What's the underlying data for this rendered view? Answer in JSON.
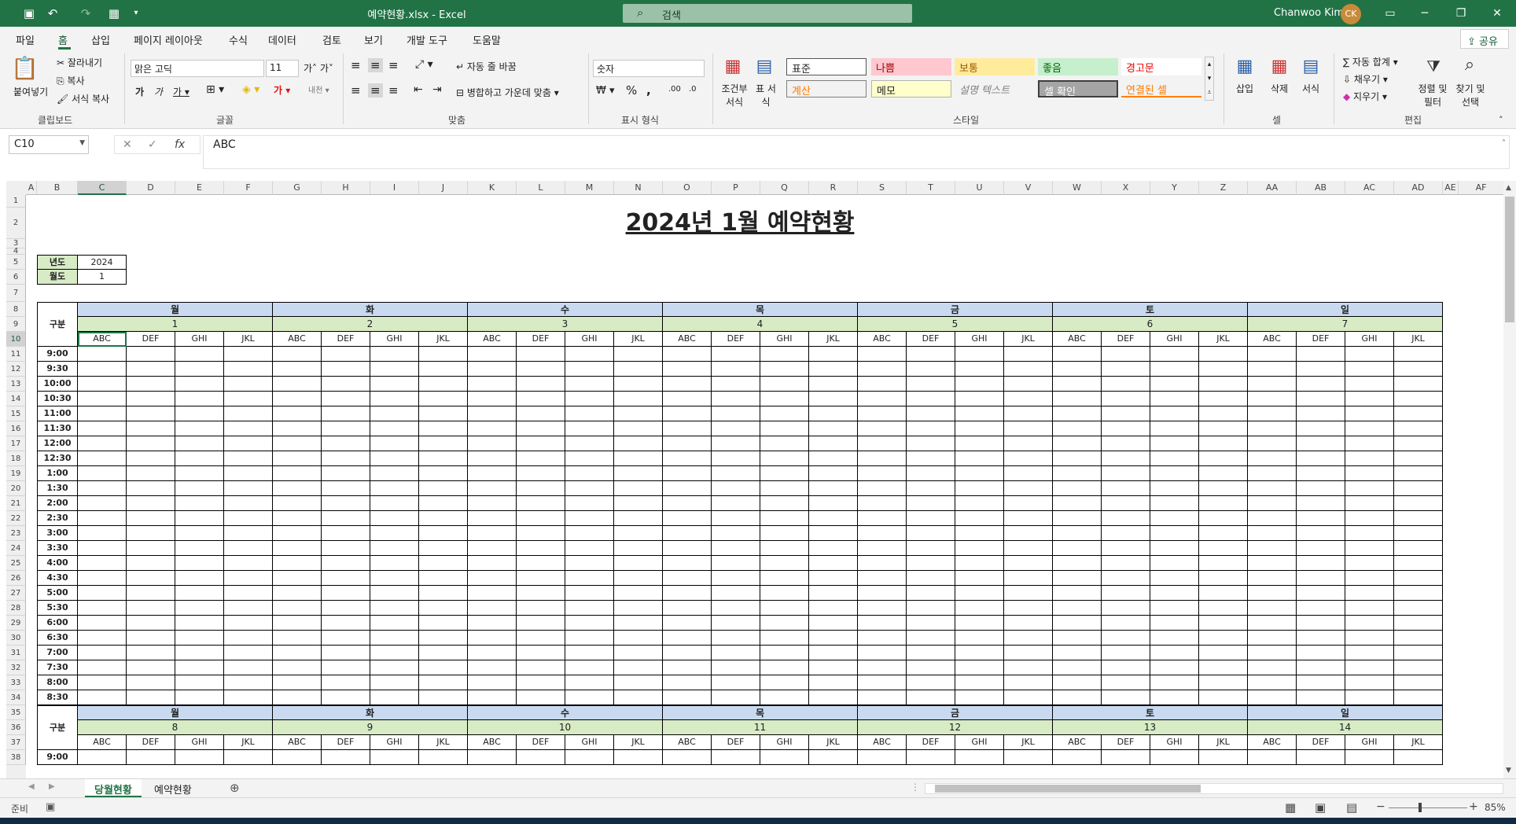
{
  "title_bar": {
    "file_title": "예약현황.xlsx  -  Excel",
    "search_placeholder": "검색",
    "user_name": "Chanwoo Kim",
    "user_initials": "CK"
  },
  "menu": {
    "tabs": [
      "파일",
      "홈",
      "삽입",
      "페이지 레이아웃",
      "수식",
      "데이터",
      "검토",
      "보기",
      "개발 도구",
      "도움말"
    ],
    "active": "홈",
    "share_label": "공유"
  },
  "ribbon": {
    "clipboard": {
      "paste": "붙여넣기",
      "cut": "잘라내기",
      "copy": "복사",
      "format_painter": "서식 복사",
      "group": "클립보드"
    },
    "font": {
      "name": "맑은 고딕",
      "size": "11",
      "group": "글꼴"
    },
    "align": {
      "wrap": "자동 줄 바꿈",
      "merge": "병합하고 가운데 맞춤",
      "group": "맞춤"
    },
    "number": {
      "format": "숫자",
      "group": "표시 형식"
    },
    "styles": {
      "cond_format": "조건부 서식",
      "table_format": "표 서식",
      "cells": [
        "표준",
        "나쁨",
        "보통",
        "좋음",
        "경고문",
        "계산",
        "메모",
        "설명 텍스트",
        "셀 확인",
        "연결된 셀"
      ],
      "group": "스타일"
    },
    "cells": {
      "insert": "삽입",
      "delete": "삭제",
      "format": "서식",
      "group": "셀"
    },
    "editing": {
      "autosum": "자동 합계",
      "fill": "채우기",
      "clear": "지우기",
      "sort": "정렬 및 필터",
      "find": "찾기 및 선택",
      "group": "편집"
    }
  },
  "formula_bar": {
    "name_box": "C10",
    "formula": "ABC"
  },
  "columns": [
    "A",
    "B",
    "C",
    "D",
    "E",
    "F",
    "G",
    "H",
    "I",
    "J",
    "K",
    "L",
    "M",
    "N",
    "O",
    "P",
    "Q",
    "R",
    "S",
    "T",
    "U",
    "V",
    "W",
    "X",
    "Y",
    "Z",
    "AA",
    "AB",
    "AC",
    "AD",
    "AE",
    "AF"
  ],
  "sheet": {
    "title": "2024년 1월 예약현황",
    "year_label": "년도",
    "year_value": "2024",
    "month_label": "월도",
    "month_value": "1",
    "category_label": "구분",
    "days": [
      "월",
      "화",
      "수",
      "목",
      "금",
      "토",
      "일"
    ],
    "week1_dates": [
      "1",
      "2",
      "3",
      "4",
      "5",
      "6",
      "7"
    ],
    "week2_dates": [
      "8",
      "9",
      "10",
      "11",
      "12",
      "13",
      "14"
    ],
    "resources": [
      "ABC",
      "DEF",
      "GHI",
      "JKL"
    ],
    "times": [
      "9:00",
      "9:30",
      "10:00",
      "10:30",
      "11:00",
      "11:30",
      "12:00",
      "12:30",
      "1:00",
      "1:30",
      "2:00",
      "2:30",
      "3:00",
      "3:30",
      "4:00",
      "4:30",
      "5:00",
      "5:30",
      "6:00",
      "6:30",
      "7:00",
      "7:30",
      "8:00",
      "8:30"
    ]
  },
  "sheet_tabs": {
    "tabs": [
      "당월현황",
      "예약현황"
    ],
    "active": "당월현황"
  },
  "status": {
    "ready": "준비",
    "zoom": "85%"
  },
  "colors": {
    "excel_green": "#217346",
    "day_header": "#c9daf0",
    "date_header": "#d7ebc5",
    "label_fill": "#d7ebc5"
  }
}
